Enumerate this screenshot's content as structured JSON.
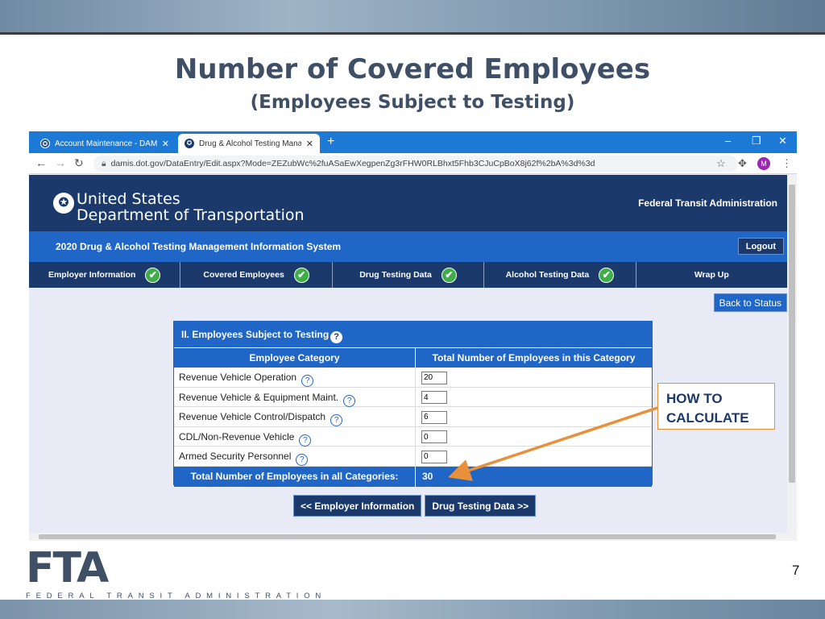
{
  "slide": {
    "title": "Number of Covered Employees",
    "subtitle": "(Employees Subject to Testing)",
    "page_number": "7",
    "logo_text": "FTA",
    "logo_full": "FEDERAL TRANSIT ADMINISTRATION",
    "callout": "HOW TO CALCULATE"
  },
  "browser": {
    "tabs": [
      {
        "label": "Account Maintenance - DAMIS A",
        "close": "✕"
      },
      {
        "label": "Drug & Alcohol Testing Managem",
        "close": "✕"
      }
    ],
    "new_tab": "+",
    "url": "damis.dot.gov/DataEntry/Edit.aspx?Mode=ZEZubWc%2fuASaEwXegpenZg3rFHW0RLBhxt5Fhb3CJuCpBoX8j62f%2bA%3d%3d",
    "avatar_letter": "M"
  },
  "site": {
    "dot_name_line1": "United States",
    "dot_name_line2": "Department of Transportation",
    "fta_name": "Federal Transit Administration",
    "system_title": "2020 Drug & Alcohol Testing Management Information System",
    "logout_label": "Logout",
    "steps": [
      {
        "label": "Employer Information",
        "complete": true
      },
      {
        "label": "Covered Employees",
        "complete": true
      },
      {
        "label": "Drug Testing Data",
        "complete": true
      },
      {
        "label": "Alcohol Testing Data",
        "complete": true
      },
      {
        "label": "Wrap Up",
        "complete": false
      }
    ],
    "back_to_status": "Back to Status"
  },
  "form": {
    "section_title": "II. Employees Subject to Testing",
    "col_category": "Employee Category",
    "col_total": "Total Number of Employees in this Category",
    "rows": [
      {
        "category": "Revenue Vehicle Operation",
        "value": "20"
      },
      {
        "category": "Revenue Vehicle & Equipment Maint.",
        "value": "4"
      },
      {
        "category": "Revenue Vehicle Control/Dispatch",
        "value": "6"
      },
      {
        "category": "CDL/Non-Revenue Vehicle",
        "value": "0"
      },
      {
        "category": "Armed Security Personnel",
        "value": "0"
      }
    ],
    "total_label": "Total Number of Employees in all Categories:",
    "total_value": "30",
    "prev_button": "<< Employer Information",
    "next_button": "Drug Testing Data >>"
  },
  "icons": {
    "help": "help-circle-icon",
    "check": "check-circle-icon",
    "lock": "lock-icon",
    "star": "star-icon",
    "extensions": "puzzle-icon",
    "menu": "kebab-menu-icon"
  },
  "colors": {
    "navy": "#1b3a6b",
    "blue": "#2066c6",
    "check_green": "#3fae49",
    "callout_orange": "#e8903a",
    "slide_text": "#3f4f65"
  }
}
